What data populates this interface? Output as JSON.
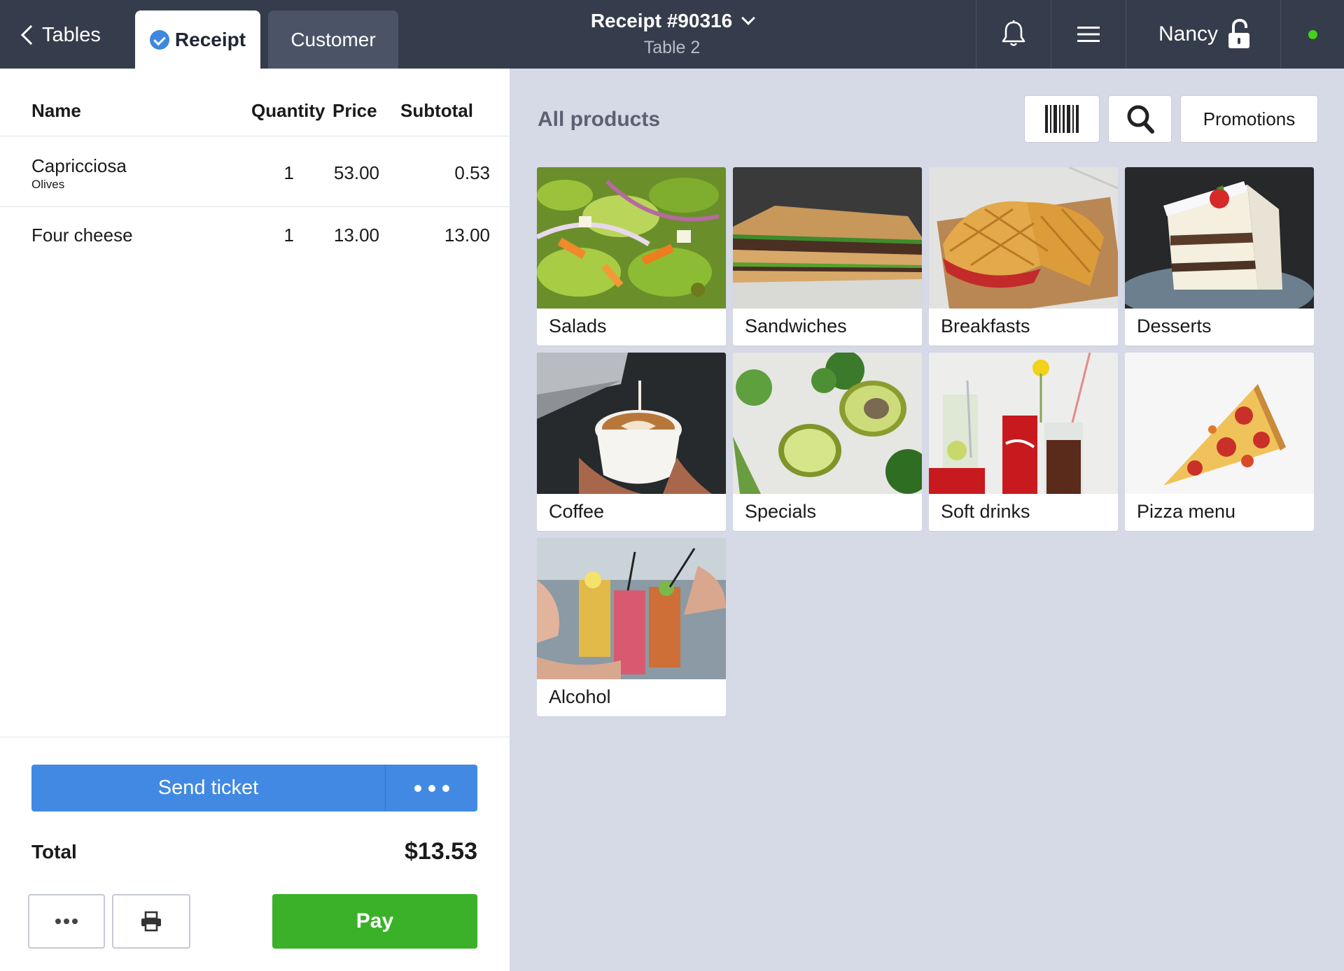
{
  "topbar": {
    "back_label": "Tables",
    "tab_receipt": "Receipt",
    "tab_customer": "Customer",
    "receipt_title": "Receipt #90316",
    "table_label": "Table 2",
    "user_name": "Nancy",
    "status_color": "#45d11e"
  },
  "receipt": {
    "headers": {
      "name": "Name",
      "quantity": "Quantity",
      "price": "Price",
      "subtotal": "Subtotal"
    },
    "rows": [
      {
        "name": "Capricciosa",
        "modifier": "Olives",
        "quantity": "1",
        "price": "53.00",
        "subtotal": "0.53"
      },
      {
        "name": "Four cheese",
        "modifier": "",
        "quantity": "1",
        "price": "13.00",
        "subtotal": "13.00"
      }
    ],
    "send_ticket": "Send ticket",
    "total_label": "Total",
    "total_value": "$13.53",
    "pay_label": "Pay"
  },
  "products": {
    "title": "All products",
    "promotions": "Promotions",
    "categories": [
      {
        "label": "Salads",
        "icon": "salad-photo"
      },
      {
        "label": "Sandwiches",
        "icon": "sandwich-photo"
      },
      {
        "label": "Breakfasts",
        "icon": "waffle-photo"
      },
      {
        "label": "Desserts",
        "icon": "cake-photo"
      },
      {
        "label": "Coffee",
        "icon": "latte-photo"
      },
      {
        "label": "Specials",
        "icon": "avocado-photo"
      },
      {
        "label": "Soft drinks",
        "icon": "cola-photo"
      },
      {
        "label": "Pizza menu",
        "icon": "pizza-photo"
      },
      {
        "label": "Alcohol",
        "icon": "cocktails-photo"
      }
    ]
  },
  "colors": {
    "topbar": "#353c4b",
    "accent_blue": "#4189e2",
    "pay_green": "#3bb12a",
    "panel_bg": "#d6d9e6"
  }
}
